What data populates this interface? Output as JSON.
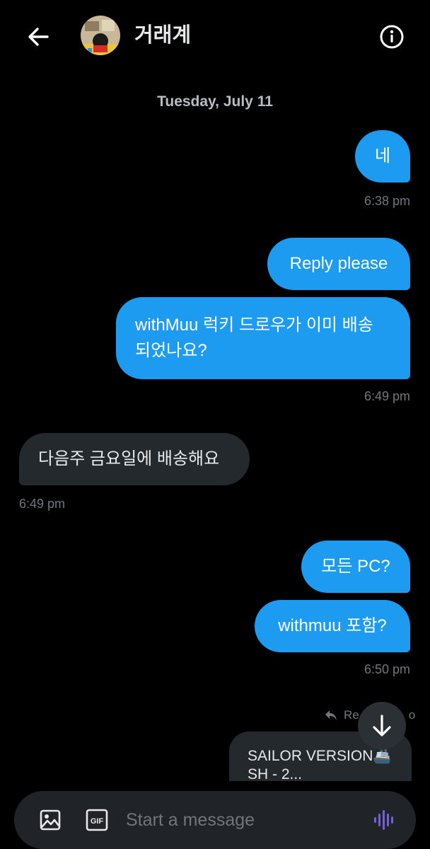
{
  "header": {
    "title": "거래계",
    "back_icon": "arrow-left-icon",
    "info_icon": "info-icon"
  },
  "conversation": {
    "date_label": "Tuesday, July 11",
    "messages": [
      {
        "text": "네",
        "direction": "out"
      },
      {
        "text": "Reply please",
        "direction": "out"
      },
      {
        "text": "withMuu 럭키 드로우가 이미 배송 되었나요?",
        "line1": "withMuu 럭키 드로우가 이미 배송",
        "line2": "되었나요?",
        "direction": "out"
      },
      {
        "text": "다음주 금요일에 배송해요",
        "direction": "in"
      },
      {
        "text": "모든 PC?",
        "direction": "out"
      },
      {
        "text": "withmuu 포함?",
        "direction": "out"
      }
    ],
    "timestamps": [
      "6:38 pm",
      "6:49 pm",
      "6:49 pm",
      "6:50 pm"
    ],
    "reply_hint": "Re",
    "reply_hint_tail": "o",
    "preview": {
      "line1": "SAILOR VERSION🚢",
      "line2": "SH - 2..."
    }
  },
  "composer": {
    "placeholder": "Start a message",
    "media_icon": "image-icon",
    "gif_label": "GIF",
    "voice_icon": "voice-waveform-icon"
  },
  "colors": {
    "background": "#000000",
    "outgoing_bubble": "#1d9bf0",
    "incoming_bubble": "#24292e",
    "muted_text": "#71767b",
    "voice_accent": "#7856ff"
  }
}
